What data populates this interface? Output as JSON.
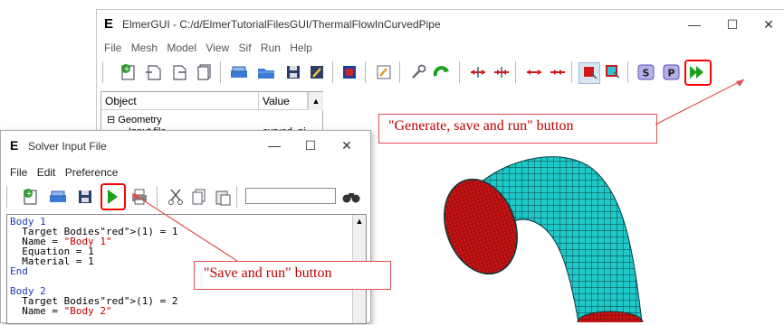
{
  "main_window": {
    "logo": "E",
    "title": "ElmerGUI - C:/d/ElmerTutorialFilesGUI/ThermalFlowInCurvedPipe",
    "minimize": "—",
    "maximize": "☐",
    "close": "✕",
    "menu": [
      "File",
      "Mesh",
      "Model",
      "View",
      "Sif",
      "Run",
      "Help"
    ],
    "tree": {
      "col_object": "Object",
      "col_value": "Value",
      "rows": [
        {
          "label": "⊟ Geometry",
          "value": ""
        },
        {
          "label": "Input file",
          "value": "curved_pi"
        }
      ]
    }
  },
  "solver_window": {
    "logo": "E",
    "title": "Solver Input File",
    "minimize": "—",
    "maximize": "☐",
    "close": "✕",
    "menu": [
      "File",
      "Edit",
      "Preference"
    ],
    "search_value": "",
    "code_lines": [
      {
        "text": "Body 1",
        "cls": "blue"
      },
      {
        "text": "  Target Bodies(1) = 1",
        "cls": ""
      },
      {
        "text": "  Name = \"Body 1\"",
        "cls": ""
      },
      {
        "text": "  Equation = 1",
        "cls": ""
      },
      {
        "text": "  Material = 1",
        "cls": ""
      },
      {
        "text": "End",
        "cls": "blue"
      },
      {
        "text": "",
        "cls": ""
      },
      {
        "text": "Body 2",
        "cls": "blue"
      },
      {
        "text": "  Target Bodies(1) = 2",
        "cls": ""
      },
      {
        "text": "  Name = \"Body 2\"",
        "cls": ""
      }
    ]
  },
  "annotations": {
    "generate_callout": "\"Generate, save and run\" button",
    "save_run_callout": "\"Save and run\" button",
    "highlight_color": "#ff0000"
  },
  "colors": {
    "pipe_teal": "#1ec8c8",
    "pipe_inner_red": "#c81414",
    "run_green": "#1aa01a"
  },
  "icons": {
    "main_toolbar": [
      "open-mesh-icon",
      "open-file-icon",
      "load-project-icon",
      "new-icon",
      "save-project-icon",
      "open-project-icon",
      "save-icon",
      "edit-icon",
      "palette-icon",
      "pencil-icon",
      "wrench-icon",
      "rotate-icon",
      "split-icon",
      "unite-icon",
      "divide-icon",
      "join-icon",
      "select-surface-icon",
      "select-edge-icon",
      "solver-icon",
      "post-icon",
      "generate-save-run-icon"
    ]
  }
}
